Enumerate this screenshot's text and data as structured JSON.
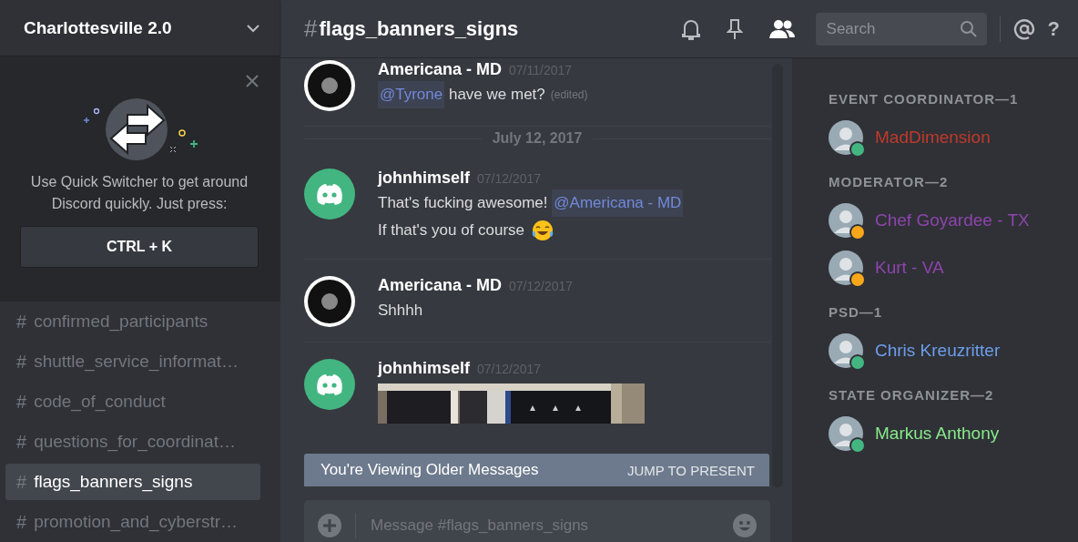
{
  "server": {
    "name": "Charlottesville 2.0"
  },
  "quick_switcher": {
    "text": "Use Quick Switcher to get around Discord quickly. Just press:",
    "shortcut": "CTRL + K"
  },
  "channels": [
    {
      "icon": "#",
      "name": "confirmed_participants",
      "selected": false
    },
    {
      "icon": "#",
      "name": "shuttle_service_informat…",
      "selected": false
    },
    {
      "icon": "#",
      "name": "code_of_conduct",
      "selected": false
    },
    {
      "icon": "#",
      "name": "questions_for_coordinat…",
      "selected": false
    },
    {
      "icon": "#",
      "name": "flags_banners_signs",
      "selected": true
    },
    {
      "icon": "#",
      "name": "promotion_and_cyberstr…",
      "selected": false
    }
  ],
  "header": {
    "hash": "#",
    "channel": "flags_banners_signs",
    "search": {
      "placeholder": "Search"
    },
    "help": "?"
  },
  "messages": [
    {
      "kind": "message",
      "avatar": {
        "kind": "custom"
      },
      "author": "Americana - MD",
      "time": "07/11/2017",
      "lines": [
        [
          {
            "kind": "mention",
            "text": "@Tyrone"
          },
          {
            "kind": "text",
            "text": " have we met?"
          },
          {
            "kind": "edited",
            "text": "(edited)"
          }
        ]
      ]
    },
    {
      "kind": "divider",
      "text": "July 12, 2017"
    },
    {
      "kind": "message",
      "avatar": {
        "kind": "default"
      },
      "author": "johnhimself",
      "time": "07/12/2017",
      "lines": [
        [
          {
            "kind": "text",
            "text": "That's fucking awesome! "
          },
          {
            "kind": "mention",
            "text": "@Americana - MD"
          }
        ],
        [
          {
            "kind": "text",
            "text": "If that's you of course "
          },
          {
            "kind": "emoji"
          }
        ]
      ]
    },
    {
      "kind": "message",
      "avatar": {
        "kind": "custom"
      },
      "author": "Americana - MD",
      "time": "07/12/2017",
      "lines": [
        [
          {
            "kind": "text",
            "text": "Shhhh"
          }
        ]
      ]
    },
    {
      "kind": "message",
      "avatar": {
        "kind": "default"
      },
      "author": "johnhimself",
      "time": "07/12/2017"
    }
  ],
  "older_banner": {
    "text": "You're Viewing Older Messages",
    "action": "JUMP TO PRESENT"
  },
  "composer": {
    "placeholder": "Message #flags_banners_signs"
  },
  "member_groups": [
    {
      "title": "EVENT COORDINATOR—1",
      "members": [
        {
          "name": "MadDimension",
          "color": "#c0392b",
          "status": {
            "color": "#43b581"
          }
        }
      ]
    },
    {
      "title": "MODERATOR—2",
      "members": [
        {
          "name": "Chef Goyardee - TX",
          "color": "#8e44ad",
          "status": {
            "color": "#faa61a"
          }
        },
        {
          "name": "Kurt - VA",
          "color": "#8e44ad",
          "status": {
            "color": "#faa61a"
          }
        }
      ]
    },
    {
      "title": "PSD—1",
      "members": [
        {
          "name": "Chris Kreuzritter",
          "color": "#6d9eeb",
          "status": {
            "color": "#43b581"
          }
        }
      ]
    },
    {
      "title": "STATE ORGANIZER—2",
      "members": [
        {
          "name": "Markus Anthony",
          "color": "#87e98b",
          "status": {
            "color": "#43b581"
          }
        }
      ]
    }
  ]
}
